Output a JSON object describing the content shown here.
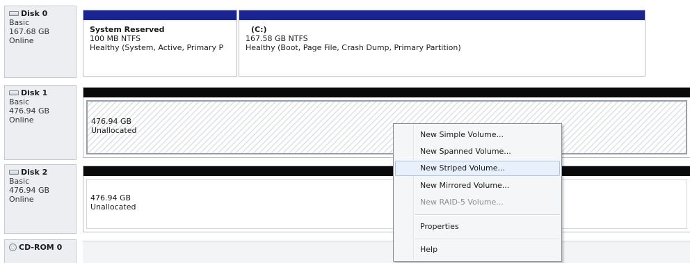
{
  "disks": [
    {
      "name": "Disk 0",
      "type": "Basic",
      "size": "167.68 GB",
      "status": "Online",
      "partitions": [
        {
          "name": "System Reserved",
          "size_fs": "100 MB NTFS",
          "health": "Healthy (System, Active, Primary P"
        },
        {
          "name": "(C:)",
          "size_fs": "167.58 GB NTFS",
          "health": "Healthy (Boot, Page File, Crash Dump, Primary Partition)"
        }
      ]
    },
    {
      "name": "Disk 1",
      "type": "Basic",
      "size": "476.94 GB",
      "status": "Online",
      "partitions": [
        {
          "size": "476.94 GB",
          "state": "Unallocated"
        }
      ]
    },
    {
      "name": "Disk 2",
      "type": "Basic",
      "size": "476.94 GB",
      "status": "Online",
      "partitions": [
        {
          "size": "476.94 GB",
          "state": "Unallocated"
        }
      ]
    },
    {
      "name": "CD-ROM 0"
    }
  ],
  "context_menu": {
    "items": [
      {
        "label": "New Simple Volume...",
        "enabled": true
      },
      {
        "label": "New Spanned Volume...",
        "enabled": true
      },
      {
        "label": "New Striped Volume...",
        "enabled": true,
        "highlighted": true
      },
      {
        "label": "New Mirrored Volume...",
        "enabled": true
      },
      {
        "label": "New RAID-5 Volume...",
        "enabled": false
      },
      {
        "label": "Properties",
        "enabled": true
      },
      {
        "label": "Help",
        "enabled": true
      }
    ]
  },
  "colors": {
    "primary_partition_bar": "#1a2591",
    "unallocated_bar": "#0a0a0a",
    "menu_highlight": "#e7f0fb"
  },
  "icons": {
    "disk": "hard-disk-icon",
    "cdrom": "cd-rom-icon"
  }
}
